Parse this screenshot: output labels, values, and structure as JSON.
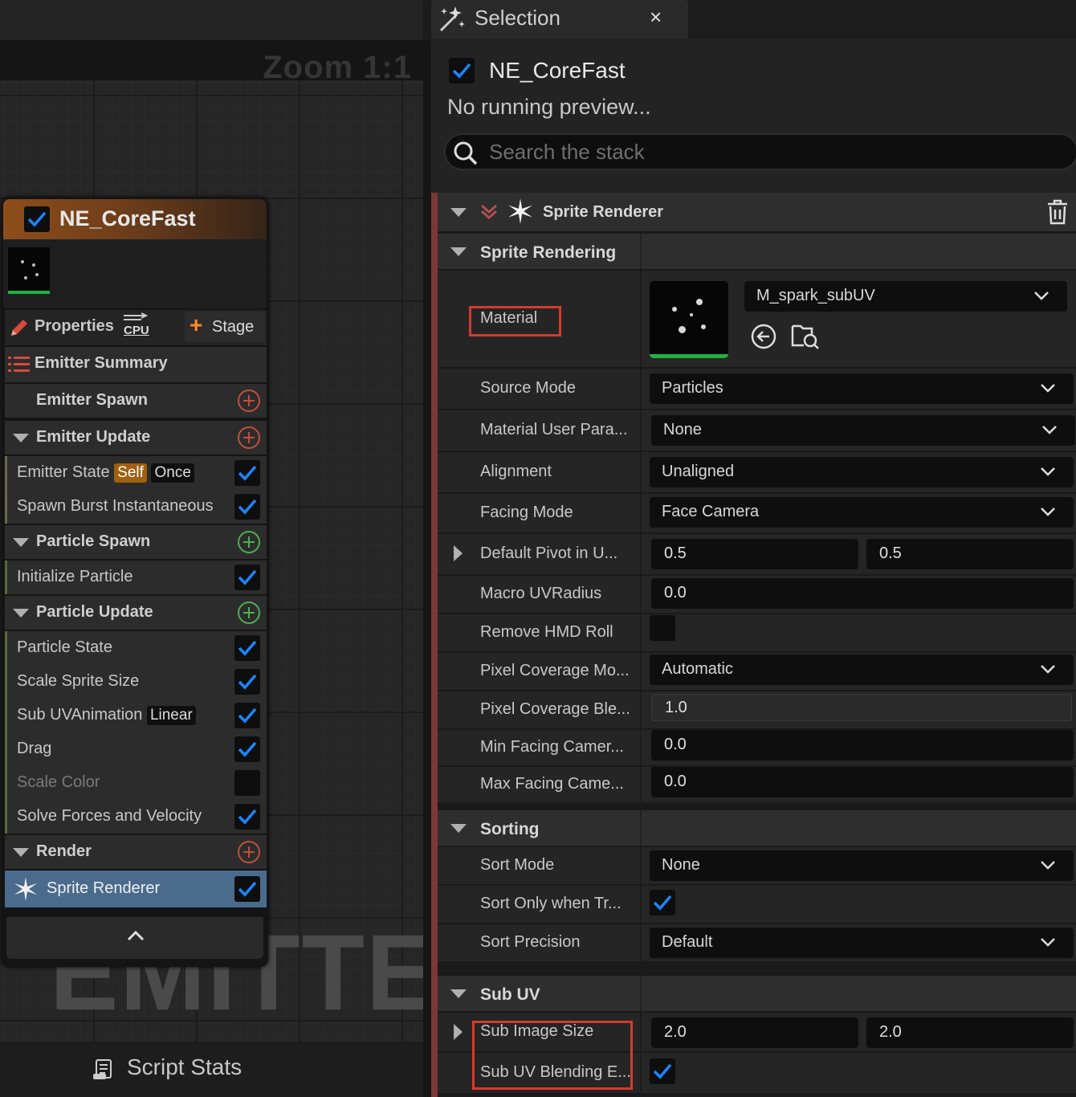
{
  "graph": {
    "zoom_label": "Zoom 1:1",
    "watermark": "EMITTER",
    "script_stats_label": "Script Stats"
  },
  "node": {
    "title": "NE_CoreFast",
    "properties_label": "Properties",
    "cpu_badge": "CPU",
    "stage_label": "Stage",
    "emitter_summary_label": "Emitter Summary",
    "emitter_spawn_label": "Emitter Spawn",
    "emitter_update_label": "Emitter Update",
    "emitter_state_label": "Emitter State",
    "emitter_state_tag1": "Self",
    "emitter_state_tag2": "Once",
    "spawn_burst_label": "Spawn Burst Instantaneous",
    "particle_spawn_label": "Particle Spawn",
    "initialize_particle_label": "Initialize Particle",
    "particle_update_label": "Particle Update",
    "particle_state_label": "Particle State",
    "scale_sprite_size_label": "Scale Sprite Size",
    "sub_uv_animation_label": "Sub UVAnimation",
    "sub_uv_animation_tag": "Linear",
    "drag_label": "Drag",
    "scale_color_label": "Scale Color",
    "solve_forces_label": "Solve Forces and Velocity",
    "render_label": "Render",
    "sprite_renderer_label": "Sprite Renderer"
  },
  "tab": {
    "label": "Selection",
    "close": "×"
  },
  "panel": {
    "emitter_name": "NE_CoreFast",
    "preview_status": "No running preview...",
    "search_placeholder": "Search the stack",
    "renderer_title": "Sprite Renderer",
    "sections": {
      "sprite_rendering": "Sprite Rendering",
      "sorting": "Sorting",
      "sub_uv": "Sub UV"
    },
    "props": {
      "material_label": "Material",
      "material_value": "M_spark_subUV",
      "source_mode_label": "Source Mode",
      "source_mode_value": "Particles",
      "material_user_label": "Material User Para...",
      "material_user_value": "None",
      "alignment_label": "Alignment",
      "alignment_value": "Unaligned",
      "facing_mode_label": "Facing Mode",
      "facing_mode_value": "Face Camera",
      "default_pivot_label": "Default Pivot in U...",
      "default_pivot_x": "0.5",
      "default_pivot_y": "0.5",
      "macro_uv_label": "Macro UVRadius",
      "macro_uv_value": "0.0",
      "remove_hmd_label": "Remove HMD Roll",
      "pixel_cov_mode_label": "Pixel Coverage Mo...",
      "pixel_cov_mode_value": "Automatic",
      "pixel_cov_blend_label": "Pixel Coverage Ble...",
      "pixel_cov_blend_value": "1.0",
      "min_facing_label": "Min Facing Camer...",
      "min_facing_value": "0.0",
      "max_facing_label": "Max Facing Came...",
      "max_facing_value": "0.0",
      "sort_mode_label": "Sort Mode",
      "sort_mode_value": "None",
      "sort_only_label": "Sort Only when Tr...",
      "sort_precision_label": "Sort Precision",
      "sort_precision_value": "Default",
      "sub_image_size_label": "Sub Image Size",
      "sub_image_x": "2.0",
      "sub_image_y": "2.0",
      "sub_uv_blend_label": "Sub UV Blending E..."
    }
  },
  "colors": {
    "accent_blue": "#1a86ff",
    "highlight_red": "#d83a2a",
    "node_header": "#8e4d1a",
    "selected_row": "#4a6b8c"
  }
}
